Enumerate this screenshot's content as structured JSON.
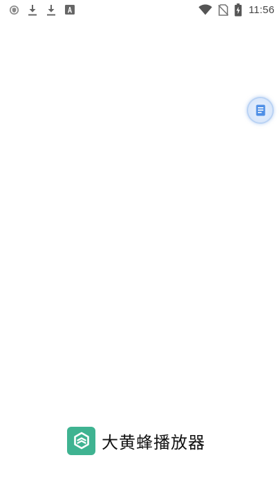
{
  "status_bar": {
    "time": "11:56",
    "left_icons": [
      "shield-icon",
      "download-icon",
      "download-icon",
      "font-a-icon"
    ],
    "right_icons": [
      "wifi-icon",
      "no-sim-icon",
      "battery-charging-icon"
    ]
  },
  "floating_button": {
    "icon": "document-icon"
  },
  "brand": {
    "name": "大黄蜂播放器",
    "logo_icon": "bee-logo-icon",
    "logo_color": "#3fb391"
  }
}
